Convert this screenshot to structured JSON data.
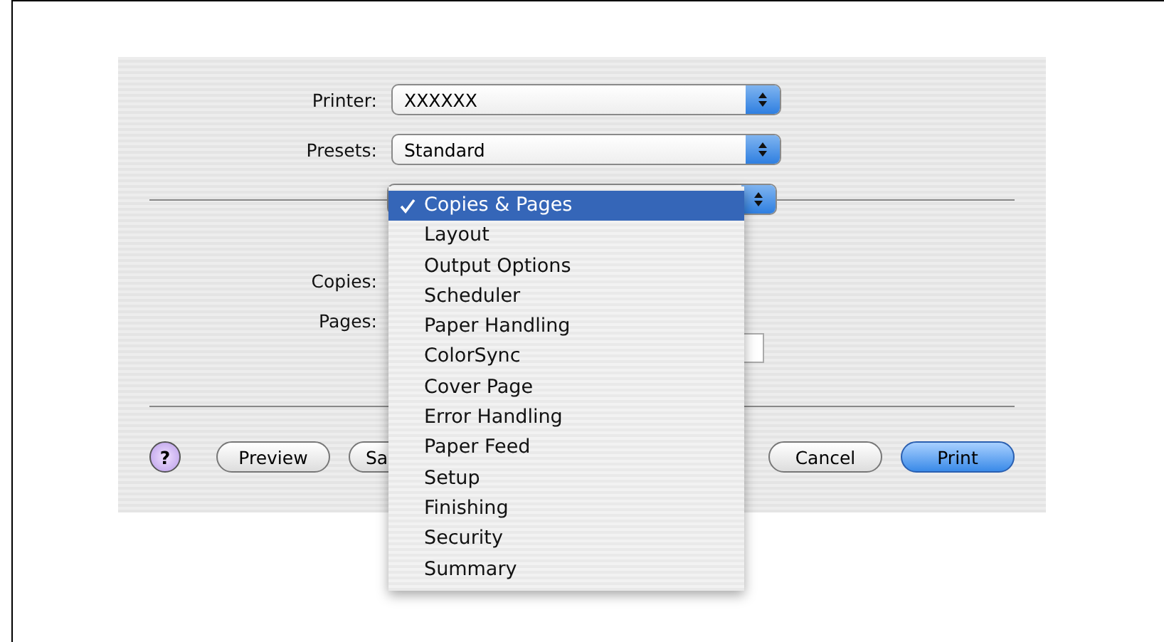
{
  "printer": {
    "label": "Printer:",
    "value": "XXXXXX"
  },
  "presets": {
    "label": "Presets:",
    "value": "Standard"
  },
  "pane_menu": {
    "items": [
      {
        "label": "Copies & Pages",
        "selected": true
      },
      {
        "label": "Layout",
        "selected": false
      },
      {
        "label": "Output Options",
        "selected": false
      },
      {
        "label": "Scheduler",
        "selected": false
      },
      {
        "label": "Paper Handling",
        "selected": false
      },
      {
        "label": "ColorSync",
        "selected": false
      },
      {
        "label": "Cover Page",
        "selected": false
      },
      {
        "label": "Error Handling",
        "selected": false
      },
      {
        "label": "Paper Feed",
        "selected": false
      },
      {
        "label": "Setup",
        "selected": false
      },
      {
        "label": "Finishing",
        "selected": false
      },
      {
        "label": "Security",
        "selected": false
      },
      {
        "label": "Summary",
        "selected": false
      }
    ]
  },
  "copies": {
    "label": "Copies:"
  },
  "pages": {
    "label": "Pages:"
  },
  "buttons": [
    {
      "kind": "help",
      "label": "?"
    },
    {
      "kind": "normal",
      "label": "Preview"
    },
    {
      "kind": "partial",
      "label": "Sa"
    },
    {
      "kind": "normal",
      "label": "Cancel"
    },
    {
      "kind": "default",
      "label": "Print"
    }
  ]
}
